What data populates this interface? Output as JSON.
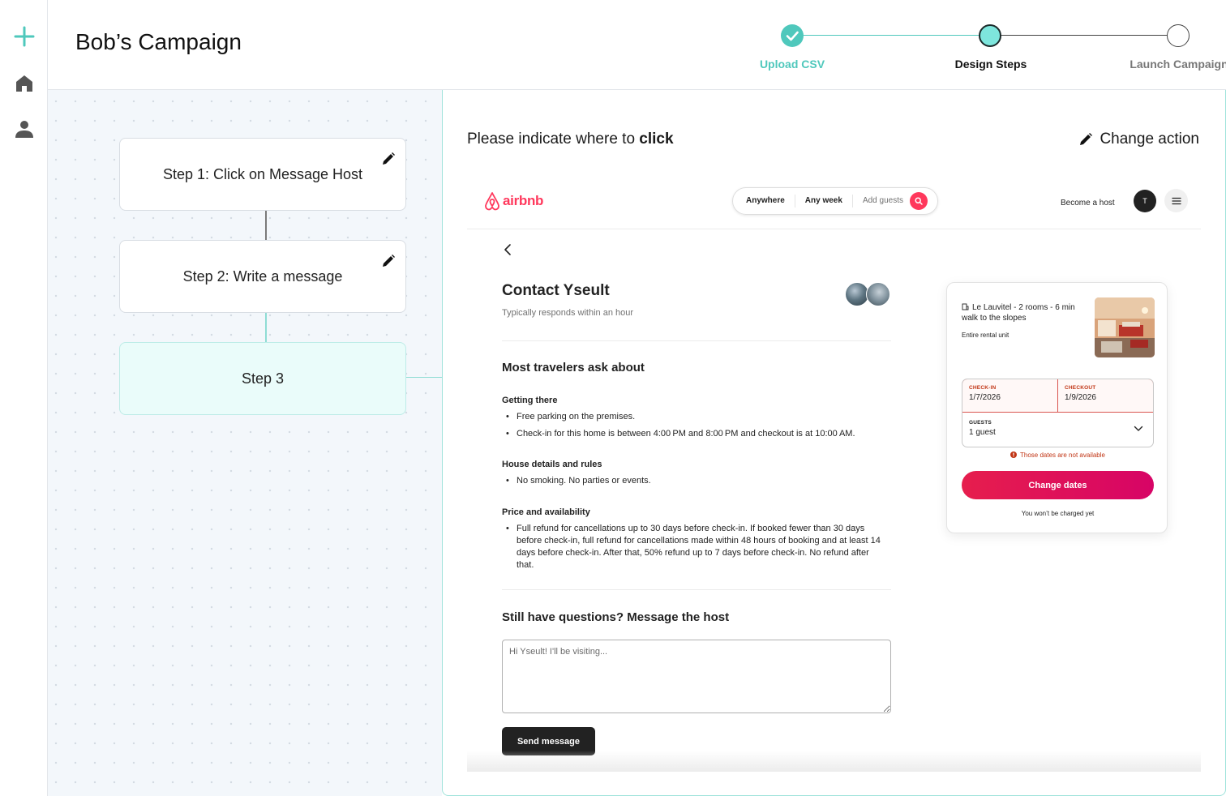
{
  "campaign": {
    "title": "Bob’s Campaign"
  },
  "stepper": {
    "steps": [
      {
        "label": "Upload CSV",
        "status": "complete"
      },
      {
        "label": "Design Steps",
        "status": "current"
      },
      {
        "label": "Launch Campaign",
        "status": "pending"
      }
    ],
    "accent_color": "#4fc8bc",
    "current_fill": "#7ee6dd"
  },
  "rail": {
    "icons": [
      "plus-icon",
      "home-icon",
      "user-icon"
    ],
    "accent_color": "#4fc8bc"
  },
  "flow": {
    "steps": [
      {
        "label": "Step 1: Click on Message Host",
        "editable": true
      },
      {
        "label": "Step 2: Write a message",
        "editable": true
      },
      {
        "label": "Step 3",
        "editable": false
      }
    ]
  },
  "panel": {
    "instruction_prefix": "Please indicate where to ",
    "instruction_action": "click",
    "change_action_label": "Change action"
  },
  "airbnb": {
    "logo_text": "airbnb",
    "brand_color": "#ff385c",
    "search": {
      "where": "Anywhere",
      "when": "Any week",
      "who": "Add guests"
    },
    "become_host": "Become a host",
    "avatar_initial": "T",
    "title": "Contact Yseult",
    "subtitle": "Typically responds within an hour",
    "faq_heading": "Most travelers ask about",
    "sections": [
      {
        "heading": "Getting there",
        "items": [
          "Free parking on the premises.",
          "Check-in for this home is between 4:00 PM and 8:00 PM and checkout is at 10:00 AM."
        ]
      },
      {
        "heading": "House details and rules",
        "items": [
          "No smoking. No parties or events."
        ]
      },
      {
        "heading": "Price and availability",
        "items": [
          "Full refund for cancellations up to 30 days before check-in. If booked fewer than 30 days before check-in, full refund for cancellations made within 48 hours of booking and at least 14 days before check-in. After that, 50% refund up to 7 days before check-in. No refund after that."
        ]
      }
    ],
    "message_heading": "Still have questions? Message the host",
    "message_placeholder": "Hi Yseult! I'll be visiting...",
    "send_label": "Send message",
    "card": {
      "listing_title": "Le Lauvitel - 2 rooms - 6 min walk to the slopes",
      "listing_type": "Entire rental unit",
      "checkin_label": "CHECK-IN",
      "checkin_value": "1/7/2026",
      "checkout_label": "CHECKOUT",
      "checkout_value": "1/9/2026",
      "guests_label": "GUESTS",
      "guests_value": "1 guest",
      "error": "Those dates are not available",
      "button": "Change dates",
      "note": "You won’t be charged yet"
    }
  }
}
